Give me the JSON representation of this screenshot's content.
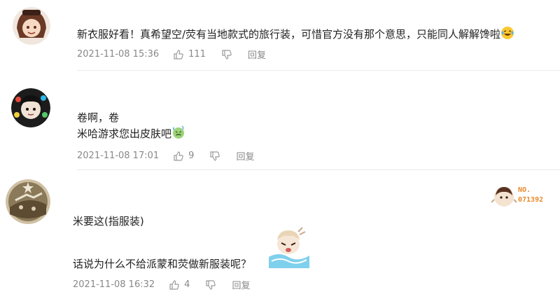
{
  "comments": [
    {
      "lines": [
        "新衣服好看！真希望空/荧有当地款式的旅行装，可惜官方没有那个意思，只能同人解解馋啦"
      ],
      "timestamp": "2021-11-08 15:36",
      "likes": "111",
      "reply_label": "回复"
    },
    {
      "lines": [
        "卷啊，卷",
        "米哈游求您出皮肤吧"
      ],
      "timestamp": "2021-11-08 17:01",
      "likes": "9",
      "reply_label": "回复"
    },
    {
      "lines": [
        "米要这(指服装)",
        "话说为什么不给派蒙和荧做新服装呢？"
      ],
      "timestamp": "2021-11-08 16:32",
      "likes": "4",
      "reply_label": "回复",
      "badge": "NO.\n071392"
    }
  ],
  "colors": {
    "text": "#222222",
    "meta": "#888888",
    "divider": "#ececec",
    "badge_orange": "#e8892b"
  },
  "icons": [
    "thumbs-up-icon",
    "thumbs-down-icon",
    "laughing-emoji-icon",
    "sweating-emoji-icon",
    "sticker-icon",
    "badge-icon"
  ]
}
